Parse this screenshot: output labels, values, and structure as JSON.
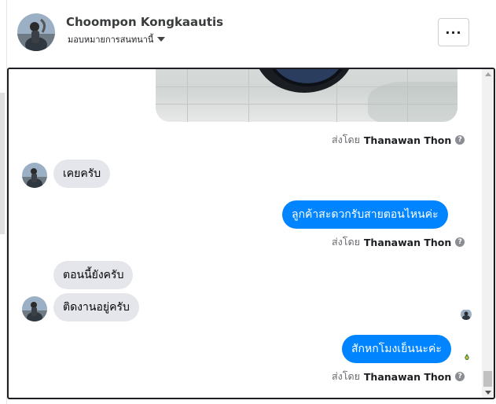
{
  "header": {
    "name": "Choompon Kongkaautis",
    "assign_label": "มอบหมายการสนทนานี้",
    "more_label": "···"
  },
  "conversation": {
    "sent_by_prefix": "ส่งโดย",
    "sent_by_name": "Thanawan Thon",
    "info_icon": "?",
    "messages": [
      {
        "from": "customer",
        "text": "เคยครับ"
      },
      {
        "from": "page",
        "text": "ลูกค้าสะดวกรับสายตอนไหนค่ะ"
      },
      {
        "from": "customer",
        "text": "ตอนนี้ยังครับ"
      },
      {
        "from": "customer",
        "text": "ติดงานอยู่ครับ"
      },
      {
        "from": "page",
        "text": "สักหกโมงเย็นนะค่ะ"
      }
    ]
  },
  "colors": {
    "outgoing_bubble": "#0084ff",
    "incoming_bubble": "#e4e6eb",
    "muted_text": "#65676b"
  },
  "icons": {
    "more": "more-icon",
    "caret": "caret-down-icon",
    "info": "question-icon",
    "avatar": "avatar-icon",
    "read_receipt": "read-receipt-icon"
  }
}
